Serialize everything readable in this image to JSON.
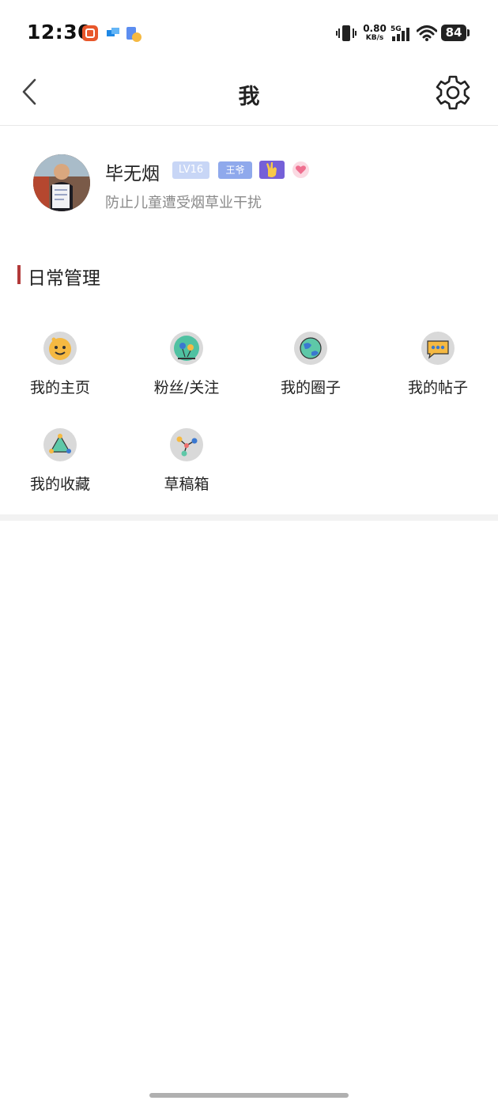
{
  "status_bar": {
    "time": "12:30",
    "net_speed_value": "0.80",
    "net_speed_unit": "KB/s",
    "network_type": "5G",
    "battery": "84"
  },
  "nav": {
    "title": "我",
    "back_icon": "chevron-left-icon",
    "settings_icon": "gear-icon"
  },
  "profile": {
    "username": "毕无烟",
    "level_badge": "LV16",
    "title_badge": "王爷",
    "bio": "防止儿童遭受烟草业干扰"
  },
  "section": {
    "title": "日常管理",
    "items": [
      {
        "label": "我的主页",
        "icon": "smiley-face-icon"
      },
      {
        "label": "粉丝/关注",
        "icon": "balloons-icon"
      },
      {
        "label": "我的圈子",
        "icon": "globe-icon"
      },
      {
        "label": "我的帖子",
        "icon": "chat-bubble-icon"
      },
      {
        "label": "我的收藏",
        "icon": "bookmark-triangle-icon"
      },
      {
        "label": "草稿箱",
        "icon": "nodes-icon"
      }
    ]
  },
  "colors": {
    "accent_bar": "#b23a3a",
    "level_badge_bg": "#c8d6f6",
    "title_badge_bg": "#8fa9ec",
    "hand_badge_bg": "#7560d8"
  }
}
